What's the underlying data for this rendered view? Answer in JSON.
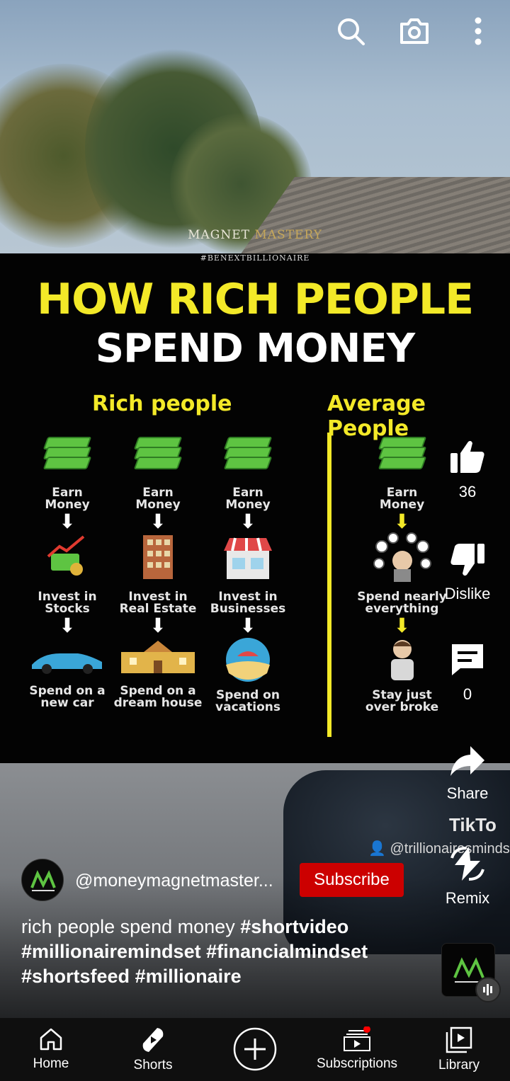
{
  "video": {
    "brand_mark": [
      "MAGNET",
      "MASTERY"
    ],
    "hashtag_line": "#BENEXTBILLIONAIRE",
    "headline": "HOW RICH PEOPLE",
    "subheadline": "SPEND MONEY",
    "rich_heading": "Rich people",
    "average_heading": "Average People",
    "columns": [
      {
        "earn": [
          "Earn",
          "Money"
        ],
        "invest": [
          "Invest in",
          "Stocks"
        ],
        "spend": [
          "Spend on a",
          "new car"
        ]
      },
      {
        "earn": [
          "Earn",
          "Money"
        ],
        "invest": [
          "Invest in",
          "Real Estate"
        ],
        "spend": [
          "Spend on a",
          "dream house"
        ]
      },
      {
        "earn": [
          "Earn",
          "Money"
        ],
        "invest": [
          "Invest in",
          "Businesses"
        ],
        "spend": [
          "Spend on",
          "vacations"
        ]
      }
    ],
    "average": {
      "earn": [
        "Earn",
        "Money"
      ],
      "spend": [
        "Spend nearly",
        "everything"
      ],
      "result": [
        "Stay just",
        "over broke"
      ]
    },
    "watermark": "TikTo",
    "watermark_user": "@trillionairesminds"
  },
  "top_bar": {
    "search": "search-icon",
    "camera": "camera-icon",
    "menu": "more-vert-icon"
  },
  "actions": {
    "likes": "36",
    "dislike_label": "Dislike",
    "comments": "0",
    "share_label": "Share",
    "remix_label": "Remix"
  },
  "channel": {
    "handle": "@moneymagnetmaster...",
    "subscribe_label": "Subscribe"
  },
  "caption": {
    "text": "rich people spend money ",
    "hashtags": [
      "#shortvideo",
      "#millionairemindset",
      "#financialmindset",
      "#shortsfeed",
      "#millionaire"
    ]
  },
  "nav": {
    "home": "Home",
    "shorts": "Shorts",
    "subscriptions": "Subscriptions",
    "library": "Library"
  },
  "colors": {
    "subscribe": "#cc0000",
    "headline": "#f3e928",
    "nav_bg": "#0f0f0f",
    "notification_dot": "#ff0000"
  }
}
